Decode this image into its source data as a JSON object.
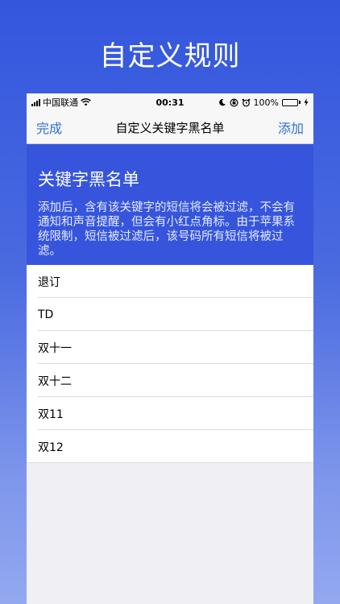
{
  "promo": {
    "title": "自定义规则"
  },
  "status_bar": {
    "carrier": "中国联通",
    "time": "00:31",
    "battery": "100%",
    "battery_level": 1.0,
    "icons": [
      "signal-icon",
      "wifi-icon",
      "moon-icon",
      "rotation-lock-icon",
      "alarm-icon",
      "battery-icon",
      "charging-icon"
    ]
  },
  "nav": {
    "left": "完成",
    "title": "自定义关键字黑名单",
    "right": "添加"
  },
  "header": {
    "heading": "关键字黑名单",
    "description": "添加后，含有该关键字的短信将会被过滤，不会有通知和声音提醒，但会有小红点角标。由于苹果系统限制，短信被过滤后，该号码所有短信将被过滤。"
  },
  "keywords": [
    "退订",
    "TD",
    "双十一",
    "双十二",
    "双11",
    "双12"
  ],
  "colors": {
    "accent": "#2f6fdb",
    "header_bg": "#3655dc",
    "battery_fill": "#4cd964"
  }
}
